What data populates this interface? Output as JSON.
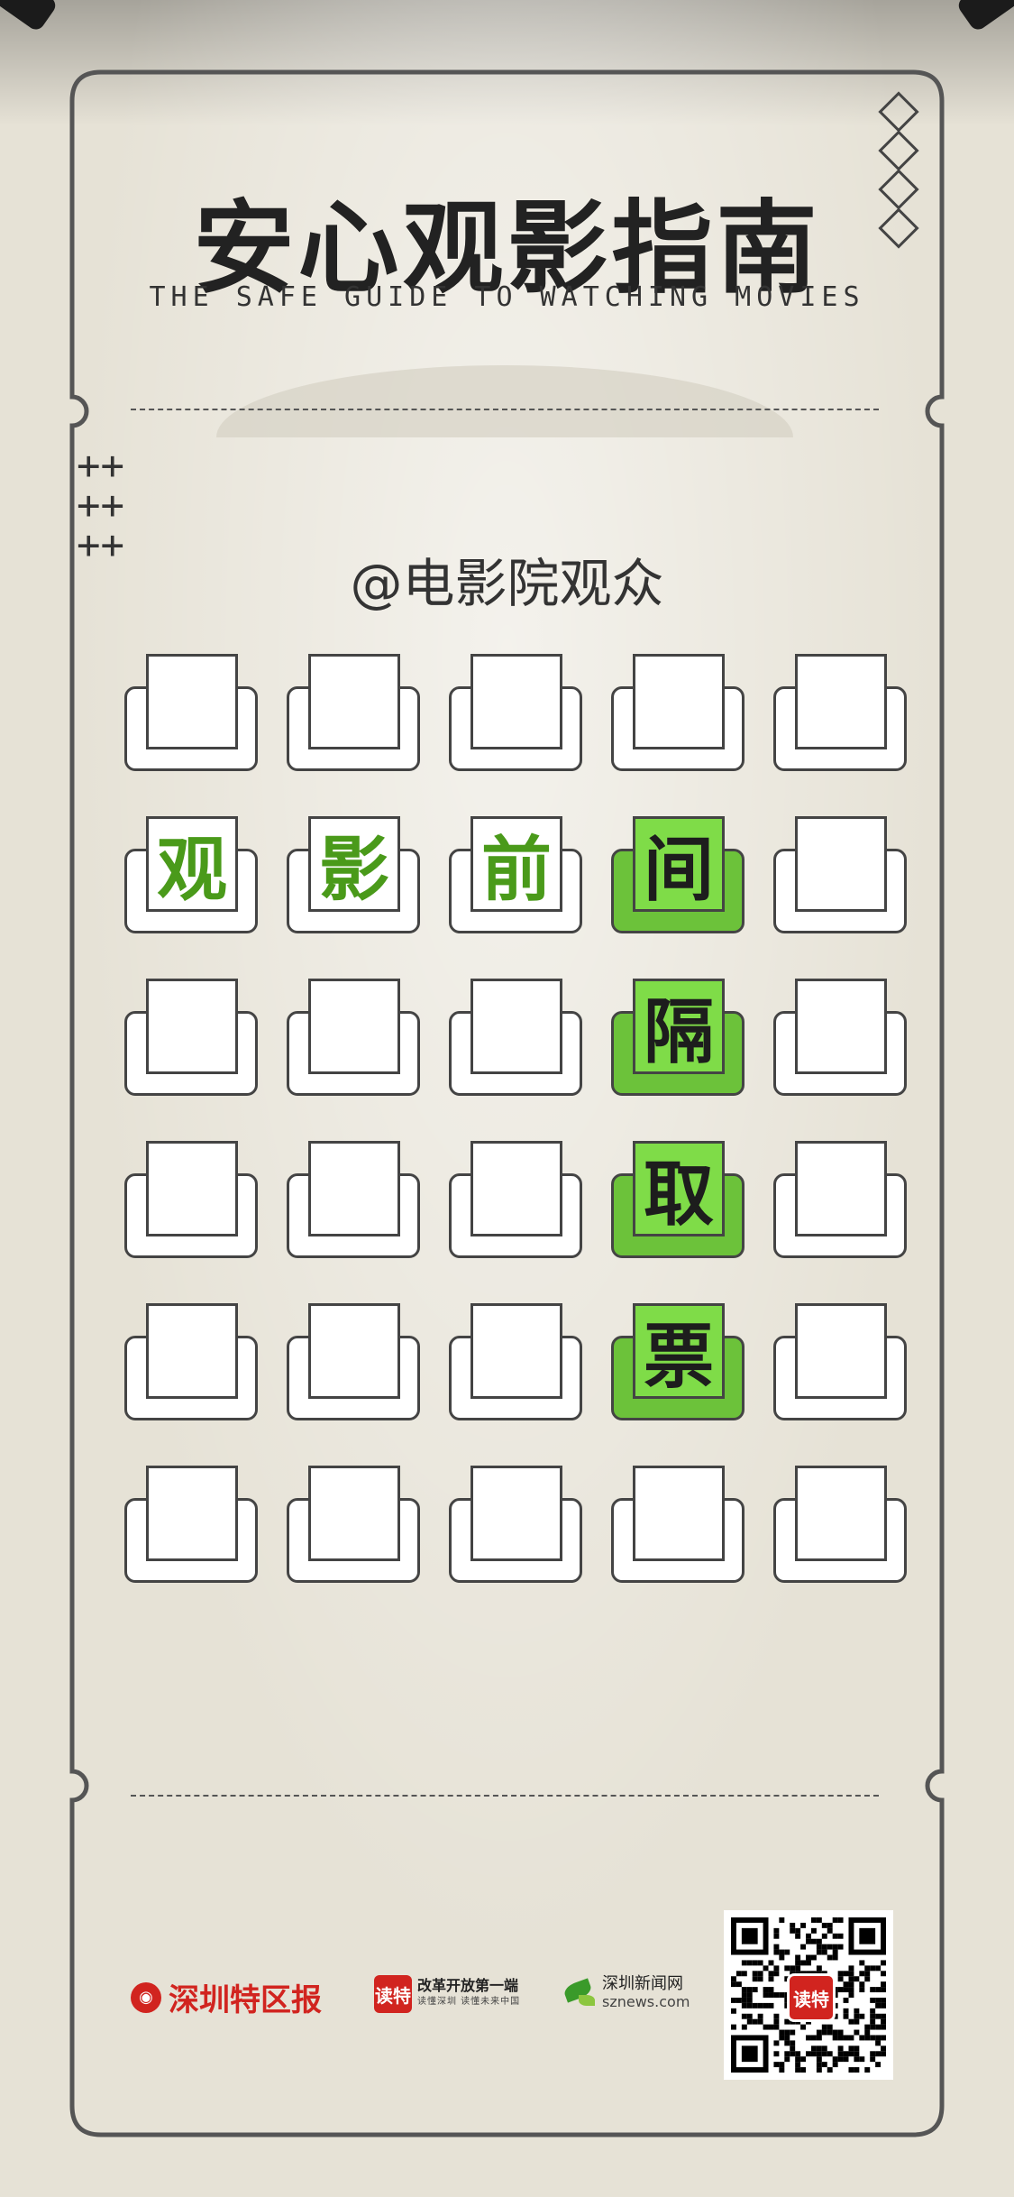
{
  "title": "安心观影指南",
  "subtitle": "THE SAFE GUIDE TO WATCHING MOVIES",
  "audience": "@电影院观众",
  "grid": {
    "rows": [
      [
        "",
        "",
        "",
        "",
        ""
      ],
      [
        "观",
        "影",
        "前",
        "间",
        ""
      ],
      [
        "",
        "",
        "",
        "隔",
        ""
      ],
      [
        "",
        "",
        "",
        "取",
        ""
      ],
      [
        "",
        "",
        "",
        "票",
        ""
      ],
      [
        "",
        "",
        "",
        "",
        ""
      ]
    ],
    "highlighted_column": 3,
    "highlight_color": "#7fdc48",
    "text_color": "#4a9a1a"
  },
  "footer": {
    "logo_shenzhen_tequ_bao": "深圳特区报",
    "logo_dute_badge": "读特",
    "logo_dute_slogan": "改革开放第一端",
    "logo_dute_sub": "读懂深圳  读懂未来中国",
    "logo_sznews_cn": "深圳新闻网",
    "logo_sznews_en": "sznews.com",
    "qr_badge": "读特"
  }
}
